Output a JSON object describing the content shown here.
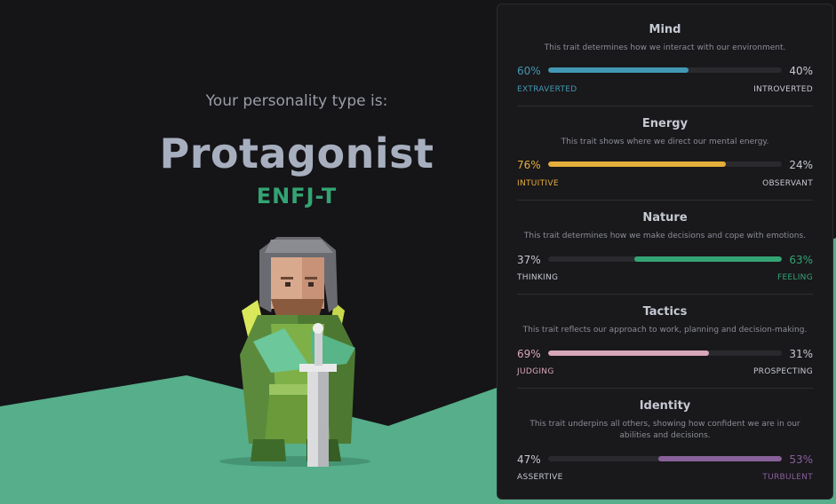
{
  "hero": {
    "lead": "Your personality type is:",
    "type_name": "Protagonist",
    "type_code": "ENFJ-T"
  },
  "traits": [
    {
      "title": "Mind",
      "description": "This trait determines how we interact with our environment.",
      "left_pct": "60%",
      "right_pct": "40%",
      "left_label": "EXTRAVERTED",
      "right_label": "INTROVERTED",
      "dominant": "left",
      "fill_fraction": 0.6,
      "color": "#4298b4"
    },
    {
      "title": "Energy",
      "description": "This trait shows where we direct our mental energy.",
      "left_pct": "76%",
      "right_pct": "24%",
      "left_label": "INTUITIVE",
      "right_label": "OBSERVANT",
      "dominant": "left",
      "fill_fraction": 0.76,
      "color": "#e4ae3a"
    },
    {
      "title": "Nature",
      "description": "This trait determines how we make decisions and cope with emotions.",
      "left_pct": "37%",
      "right_pct": "63%",
      "left_label": "THINKING",
      "right_label": "FEELING",
      "dominant": "right",
      "fill_fraction": 0.63,
      "color": "#33a474"
    },
    {
      "title": "Tactics",
      "description": "This trait reflects our approach to work, planning and decision-making.",
      "left_pct": "69%",
      "right_pct": "31%",
      "left_label": "JUDGING",
      "right_label": "PROSPECTING",
      "dominant": "left",
      "fill_fraction": 0.69,
      "color": "#d7a6b8"
    },
    {
      "title": "Identity",
      "description": "This trait underpins all others, showing how confident we are in our abilities and decisions.",
      "left_pct": "47%",
      "right_pct": "53%",
      "left_label": "ASSERTIVE",
      "right_label": "TURBULENT",
      "dominant": "right",
      "fill_fraction": 0.53,
      "color": "#88619a"
    }
  ],
  "colors": {
    "ground": "#56ae8a",
    "neutral_text": "#c5c9d2",
    "neutral_label": "#c5c9d2"
  }
}
